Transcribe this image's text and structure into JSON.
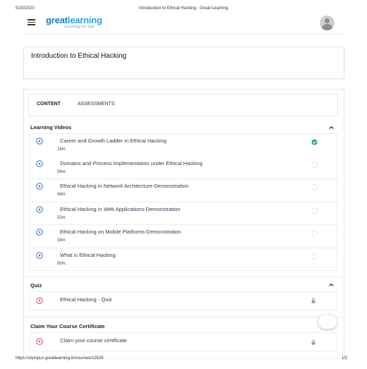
{
  "print": {
    "date": "5/20/2020",
    "doc_title": "Introduction to Ethical Hacking - Great Learning",
    "url": "https://olympus.greatlearning.in/courses/12629",
    "page": "1/2"
  },
  "header": {
    "logo_part1": "great",
    "logo_part2": "learning",
    "logo_tagline": "Learning for Life"
  },
  "course": {
    "title": "Introduction to Ethical Hacking"
  },
  "tabs": [
    {
      "label": "CONTENT",
      "active": true
    },
    {
      "label": "ASSESSMENTS",
      "active": false
    }
  ],
  "sections": {
    "videos": {
      "title": "Learning Videos",
      "items": [
        {
          "label": "Career and Growth Ladder in Ethical Hacking",
          "duration": "18m",
          "completed": true
        },
        {
          "label": "Domains and Process Implementation under Ethical Hacking",
          "duration": "54m",
          "completed": false
        },
        {
          "label": "Ethical Hacking in Network Architecture-Demonstration",
          "duration": "48m",
          "completed": false
        },
        {
          "label": "Ethical Hacking in Web Applications-Demonstration",
          "duration": "50m",
          "completed": false
        },
        {
          "label": "Ethical Hacking on Mobile Platforms-Demonstration",
          "duration": "34m",
          "completed": false
        },
        {
          "label": "What is Ethical Hacking",
          "duration": "50m",
          "completed": false
        }
      ]
    },
    "quiz": {
      "title": "Quiz",
      "items": [
        {
          "label": "Ethical Hacking - Quiz",
          "locked": true
        }
      ]
    },
    "certificate": {
      "title": "Claim Your Course Certificate",
      "items": [
        {
          "label": "Claim your course certificate",
          "locked": true
        }
      ]
    }
  },
  "colors": {
    "play_icon": "#3a6fb0",
    "complete_check": "#2fb06a",
    "quiz_icon": "#d2465a",
    "logo_dark": "#1b7bc1",
    "logo_light": "#2aa4dc"
  },
  "icons": {
    "menu": "hamburger-icon",
    "avatar": "user-avatar-icon",
    "video": "play-circle-icon",
    "quiz": "quiz-icon",
    "done": "check-circle-icon",
    "pending": "empty-circle-icon",
    "lock": "lock-icon",
    "collapse": "chevron-up-icon"
  }
}
